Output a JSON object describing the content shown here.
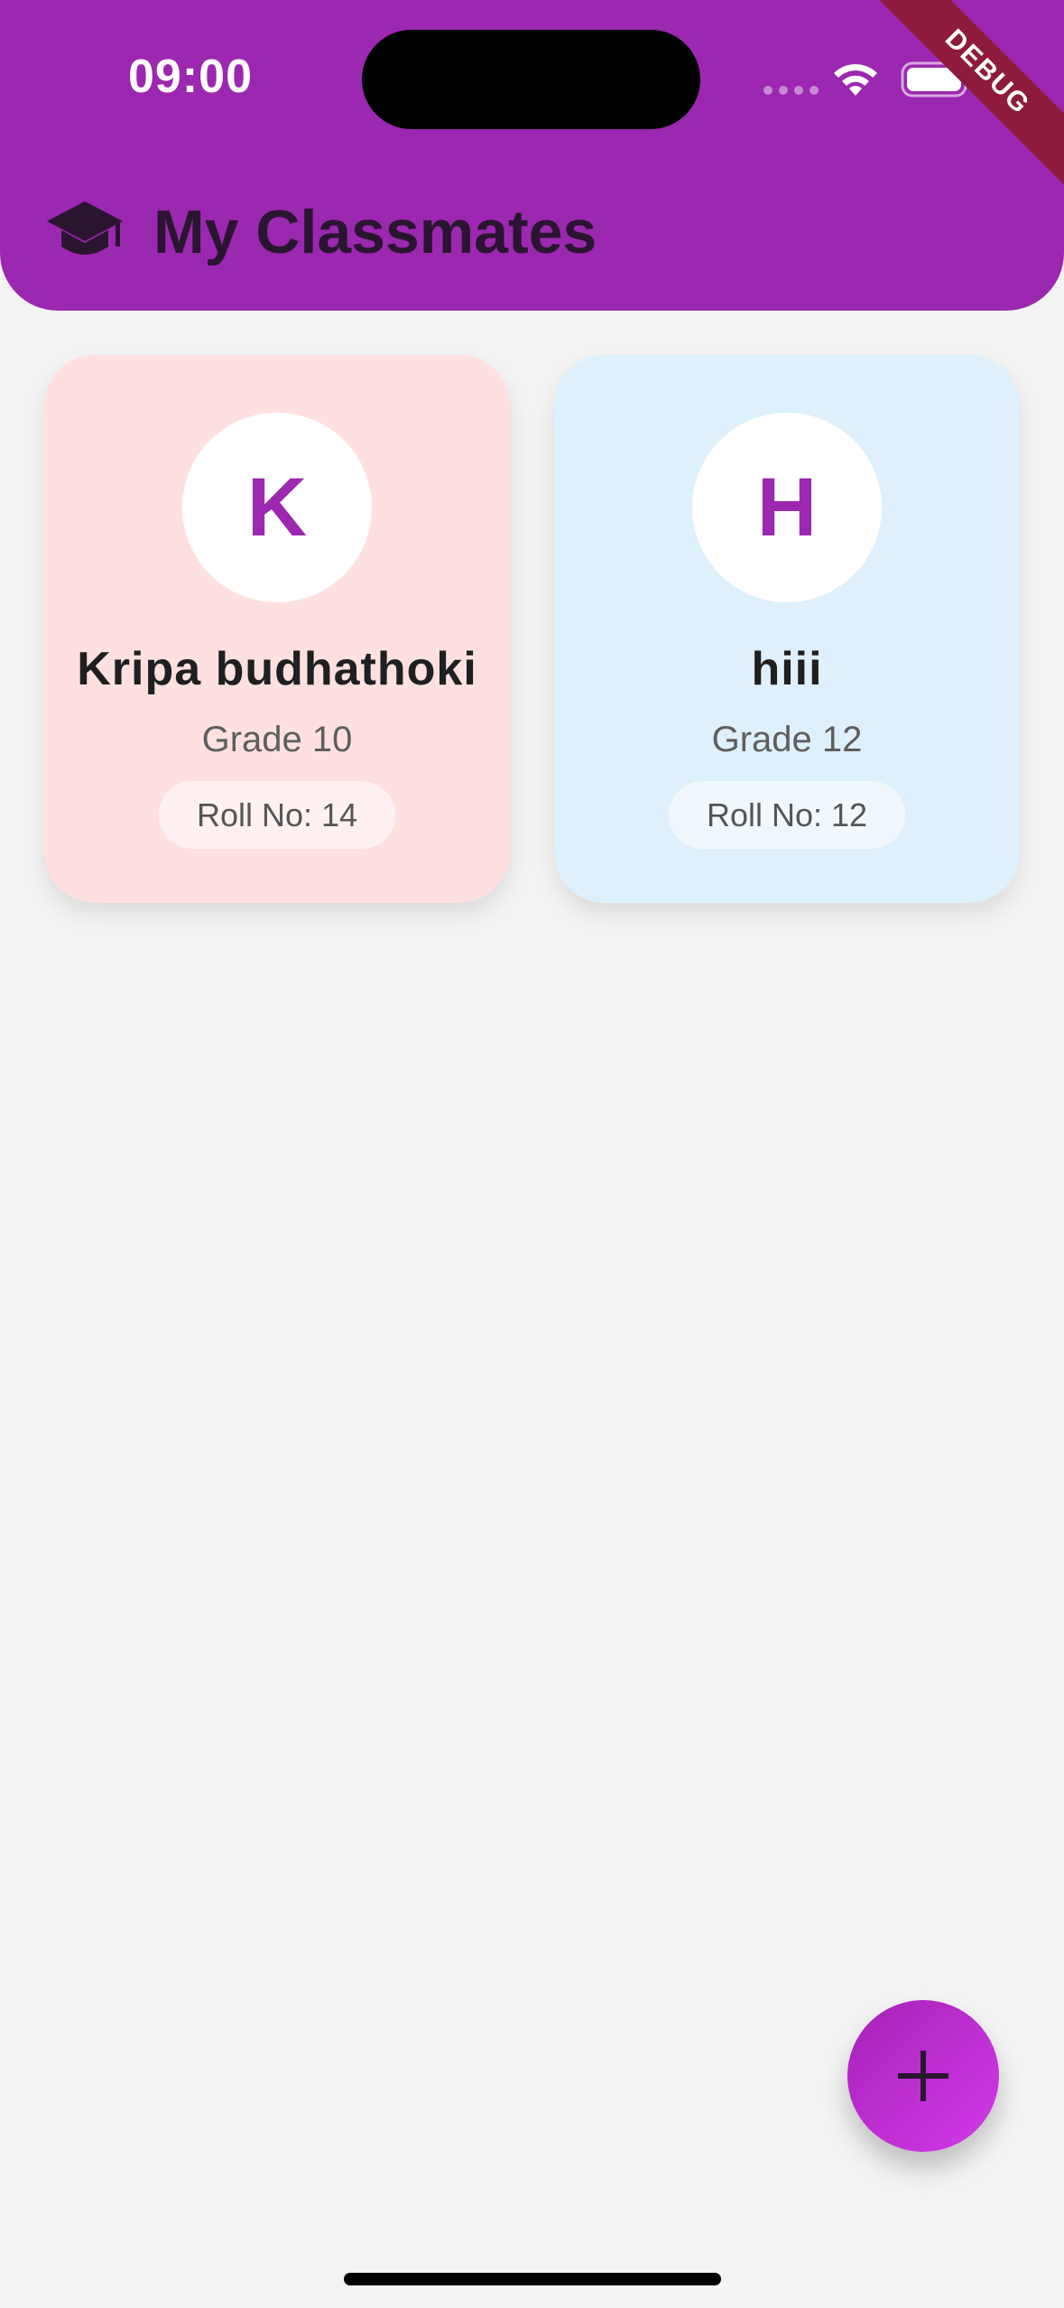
{
  "status_bar": {
    "time": "09:00"
  },
  "debug_banner": "DEBUG",
  "app_bar": {
    "title": "My Classmates",
    "icon": "graduation-cap-icon"
  },
  "classmates": [
    {
      "initial": "K",
      "name": "Kripa budhathoki",
      "grade": "Grade 10",
      "roll": "Roll No: 14",
      "card_color": "#ffe0e0"
    },
    {
      "initial": "H",
      "name": "hiii",
      "grade": "Grade 12",
      "roll": "Roll No: 12",
      "card_color": "#ddf0fc"
    }
  ],
  "fab": {
    "icon": "plus-icon"
  },
  "colors": {
    "primary": "#9c27b0",
    "background": "#f4f4f4"
  }
}
